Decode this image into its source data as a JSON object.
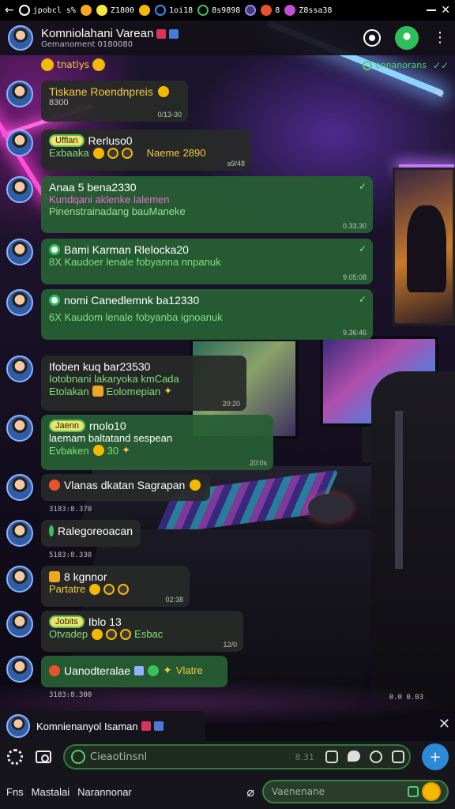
{
  "status_bar": {
    "items": [
      {
        "text": "jpobcl s%",
        "color": "#ffffff"
      },
      {
        "text": "",
        "color": "#f5a623"
      },
      {
        "text": "Z1800",
        "color": "#f5e642"
      },
      {
        "text": "",
        "color": "#f5b800"
      },
      {
        "text": "1oi18",
        "color": "#2f8fff"
      },
      {
        "text": "8s9898",
        "color": "#3ec25a"
      },
      {
        "text": "",
        "color": "#8a8aff"
      },
      {
        "text": "8",
        "color": "#e8532d"
      },
      {
        "text": "Z8ssa38",
        "color": "#c24fd8"
      }
    ]
  },
  "header": {
    "title": "Komniolahani Varean",
    "subtitle": "Gemanoment 0180080"
  },
  "chat": {
    "typing": "tnatlys",
    "online": "ennanorans",
    "messages": [
      {
        "line1": "Tiskane Roendnpreis",
        "line2": "8300",
        "time": "0/13-30"
      },
      {
        "tag": "Ufflan",
        "line1": "Rerluso0",
        "line2": "Exbaaka",
        "extra": "Naeme",
        "extra_num": "2890",
        "time": "a9/48"
      },
      {
        "line1": "Anaa 5 bena2330",
        "line2": "Kundqani aklenke lalemen",
        "line3": "Pinenstrainadang bauManeke",
        "time": "0.33.30"
      },
      {
        "line1": "Bami Karman Rlelocka20",
        "line2": "8X Kaudoer lenale fobyanna nnpanuk",
        "time": "9.05:08"
      },
      {
        "line1": "nomi Canedlemnk ba12330",
        "line2": "6X Kaudom lenale fobyanba ignoanuk",
        "time": "9.36:46"
      },
      {
        "line1": "Ifoben kuq bar23530",
        "line2": "Iotobnani lakaryoka kmCada",
        "line3": "Etolakan",
        "extra": "Eolomepian",
        "time": "20:20"
      },
      {
        "tag": "Jaenn",
        "line1": "rnolo10",
        "line2": "laemam baltatand sespean",
        "line3": "Evbaken",
        "extra": "30",
        "time": "20:0s"
      },
      {
        "line1": "Vlanas dkatan Sagrapan",
        "time_below": "3183:8.370"
      },
      {
        "line1": "Ralegoreoacan",
        "time_below": "5183:8.330"
      },
      {
        "line1": "8 kgnnor",
        "line2": "Partatre",
        "time": "02:38"
      },
      {
        "tag": "Jobits",
        "line1": "Iblo 13",
        "line2": "Otvadep",
        "extra": "Esbac",
        "time": "12/0"
      },
      {
        "line1": "Uanodteralae",
        "extra": "Vlatre",
        "time_below": "3183:8.300",
        "time_below_right": "0.0 0.03"
      }
    ]
  },
  "pinned": {
    "title": "Komnienanyol Isaman"
  },
  "composer": {
    "input_placeholder": "Cieaotinsnl",
    "counter": "8.31",
    "left_label": "Fns",
    "label": "Mastalai",
    "label2": "Narannonar",
    "input2_placeholder": "Vaenenane"
  }
}
